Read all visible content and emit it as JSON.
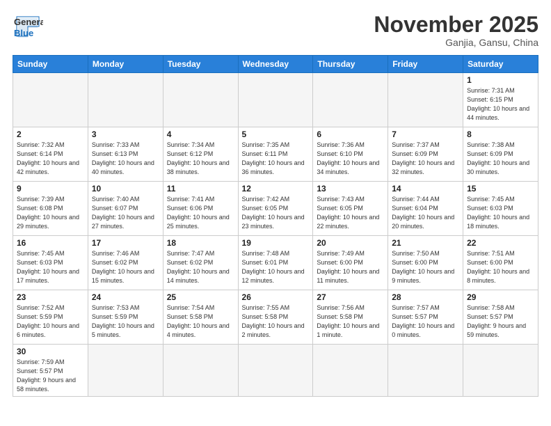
{
  "header": {
    "logo_general": "General",
    "logo_blue": "Blue",
    "month_title": "November 2025",
    "subtitle": "Ganjia, Gansu, China"
  },
  "weekdays": [
    "Sunday",
    "Monday",
    "Tuesday",
    "Wednesday",
    "Thursday",
    "Friday",
    "Saturday"
  ],
  "weeks": [
    [
      {
        "day": "",
        "info": ""
      },
      {
        "day": "",
        "info": ""
      },
      {
        "day": "",
        "info": ""
      },
      {
        "day": "",
        "info": ""
      },
      {
        "day": "",
        "info": ""
      },
      {
        "day": "",
        "info": ""
      },
      {
        "day": "1",
        "info": "Sunrise: 7:31 AM\nSunset: 6:15 PM\nDaylight: 10 hours and 44 minutes."
      }
    ],
    [
      {
        "day": "2",
        "info": "Sunrise: 7:32 AM\nSunset: 6:14 PM\nDaylight: 10 hours and 42 minutes."
      },
      {
        "day": "3",
        "info": "Sunrise: 7:33 AM\nSunset: 6:13 PM\nDaylight: 10 hours and 40 minutes."
      },
      {
        "day": "4",
        "info": "Sunrise: 7:34 AM\nSunset: 6:12 PM\nDaylight: 10 hours and 38 minutes."
      },
      {
        "day": "5",
        "info": "Sunrise: 7:35 AM\nSunset: 6:11 PM\nDaylight: 10 hours and 36 minutes."
      },
      {
        "day": "6",
        "info": "Sunrise: 7:36 AM\nSunset: 6:10 PM\nDaylight: 10 hours and 34 minutes."
      },
      {
        "day": "7",
        "info": "Sunrise: 7:37 AM\nSunset: 6:09 PM\nDaylight: 10 hours and 32 minutes."
      },
      {
        "day": "8",
        "info": "Sunrise: 7:38 AM\nSunset: 6:09 PM\nDaylight: 10 hours and 30 minutes."
      }
    ],
    [
      {
        "day": "9",
        "info": "Sunrise: 7:39 AM\nSunset: 6:08 PM\nDaylight: 10 hours and 29 minutes."
      },
      {
        "day": "10",
        "info": "Sunrise: 7:40 AM\nSunset: 6:07 PM\nDaylight: 10 hours and 27 minutes."
      },
      {
        "day": "11",
        "info": "Sunrise: 7:41 AM\nSunset: 6:06 PM\nDaylight: 10 hours and 25 minutes."
      },
      {
        "day": "12",
        "info": "Sunrise: 7:42 AM\nSunset: 6:05 PM\nDaylight: 10 hours and 23 minutes."
      },
      {
        "day": "13",
        "info": "Sunrise: 7:43 AM\nSunset: 6:05 PM\nDaylight: 10 hours and 22 minutes."
      },
      {
        "day": "14",
        "info": "Sunrise: 7:44 AM\nSunset: 6:04 PM\nDaylight: 10 hours and 20 minutes."
      },
      {
        "day": "15",
        "info": "Sunrise: 7:45 AM\nSunset: 6:03 PM\nDaylight: 10 hours and 18 minutes."
      }
    ],
    [
      {
        "day": "16",
        "info": "Sunrise: 7:45 AM\nSunset: 6:03 PM\nDaylight: 10 hours and 17 minutes."
      },
      {
        "day": "17",
        "info": "Sunrise: 7:46 AM\nSunset: 6:02 PM\nDaylight: 10 hours and 15 minutes."
      },
      {
        "day": "18",
        "info": "Sunrise: 7:47 AM\nSunset: 6:02 PM\nDaylight: 10 hours and 14 minutes."
      },
      {
        "day": "19",
        "info": "Sunrise: 7:48 AM\nSunset: 6:01 PM\nDaylight: 10 hours and 12 minutes."
      },
      {
        "day": "20",
        "info": "Sunrise: 7:49 AM\nSunset: 6:00 PM\nDaylight: 10 hours and 11 minutes."
      },
      {
        "day": "21",
        "info": "Sunrise: 7:50 AM\nSunset: 6:00 PM\nDaylight: 10 hours and 9 minutes."
      },
      {
        "day": "22",
        "info": "Sunrise: 7:51 AM\nSunset: 6:00 PM\nDaylight: 10 hours and 8 minutes."
      }
    ],
    [
      {
        "day": "23",
        "info": "Sunrise: 7:52 AM\nSunset: 5:59 PM\nDaylight: 10 hours and 6 minutes."
      },
      {
        "day": "24",
        "info": "Sunrise: 7:53 AM\nSunset: 5:59 PM\nDaylight: 10 hours and 5 minutes."
      },
      {
        "day": "25",
        "info": "Sunrise: 7:54 AM\nSunset: 5:58 PM\nDaylight: 10 hours and 4 minutes."
      },
      {
        "day": "26",
        "info": "Sunrise: 7:55 AM\nSunset: 5:58 PM\nDaylight: 10 hours and 2 minutes."
      },
      {
        "day": "27",
        "info": "Sunrise: 7:56 AM\nSunset: 5:58 PM\nDaylight: 10 hours and 1 minute."
      },
      {
        "day": "28",
        "info": "Sunrise: 7:57 AM\nSunset: 5:57 PM\nDaylight: 10 hours and 0 minutes."
      },
      {
        "day": "29",
        "info": "Sunrise: 7:58 AM\nSunset: 5:57 PM\nDaylight: 9 hours and 59 minutes."
      }
    ],
    [
      {
        "day": "30",
        "info": "Sunrise: 7:59 AM\nSunset: 5:57 PM\nDaylight: 9 hours and 58 minutes."
      },
      {
        "day": "",
        "info": ""
      },
      {
        "day": "",
        "info": ""
      },
      {
        "day": "",
        "info": ""
      },
      {
        "day": "",
        "info": ""
      },
      {
        "day": "",
        "info": ""
      },
      {
        "day": "",
        "info": ""
      }
    ]
  ]
}
